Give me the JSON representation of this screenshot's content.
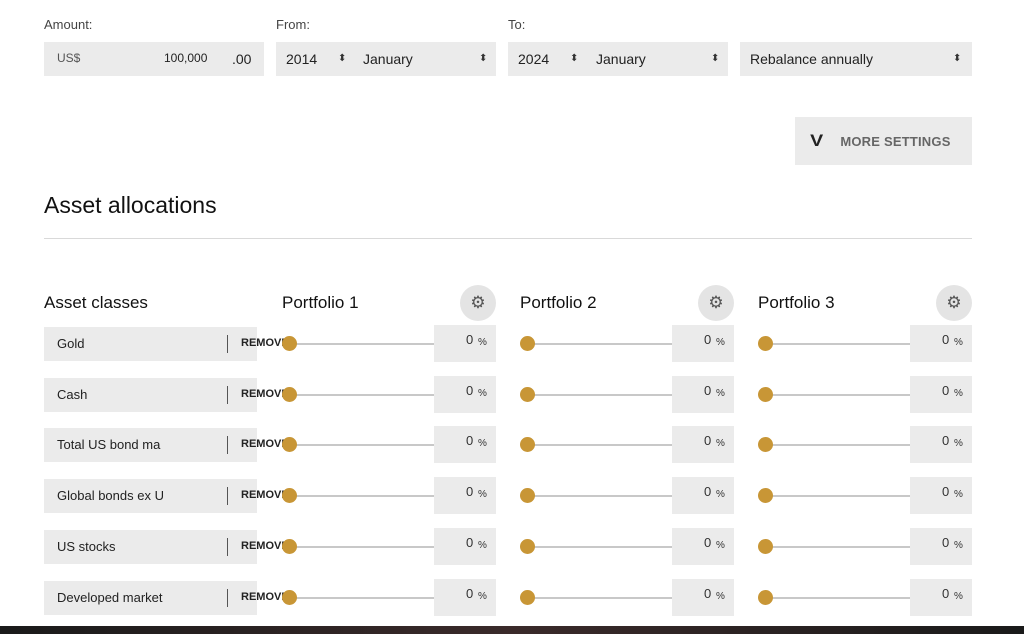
{
  "amount": {
    "label": "Amount:",
    "currency": "US$",
    "value": "100,000",
    "cents": ".00"
  },
  "from": {
    "label": "From:",
    "year": "2014",
    "month": "January"
  },
  "to": {
    "label": "To:",
    "year": "2024",
    "month": "January"
  },
  "rebalance": {
    "value": "Rebalance annually"
  },
  "more_settings": {
    "label": "MORE SETTINGS",
    "chevron": "V"
  },
  "section_title": "Asset allocations",
  "asset_classes_title": "Asset classes",
  "portfolios": [
    {
      "name": "Portfolio 1"
    },
    {
      "name": "Portfolio 2"
    },
    {
      "name": "Portfolio 3"
    }
  ],
  "remove_label": "REMOVE",
  "percent_unit": "%",
  "assets": [
    {
      "name": "Gold",
      "alloc": [
        "0",
        "0",
        "0"
      ]
    },
    {
      "name": "Cash",
      "alloc": [
        "0",
        "0",
        "0"
      ]
    },
    {
      "name": "Total US bond ma",
      "alloc": [
        "0",
        "0",
        "0"
      ]
    },
    {
      "name": "Global bonds ex U",
      "alloc": [
        "0",
        "0",
        "0"
      ]
    },
    {
      "name": "US stocks",
      "alloc": [
        "0",
        "0",
        "0"
      ]
    },
    {
      "name": "Developed market",
      "alloc": [
        "0",
        "0",
        "0"
      ]
    }
  ],
  "colors": {
    "accent": "#c89636",
    "field_bg": "#ebebeb"
  },
  "icons": {
    "gear": "gear-icon",
    "select_caret": "updown-caret-icon",
    "chevron": "chevron-down-icon"
  }
}
